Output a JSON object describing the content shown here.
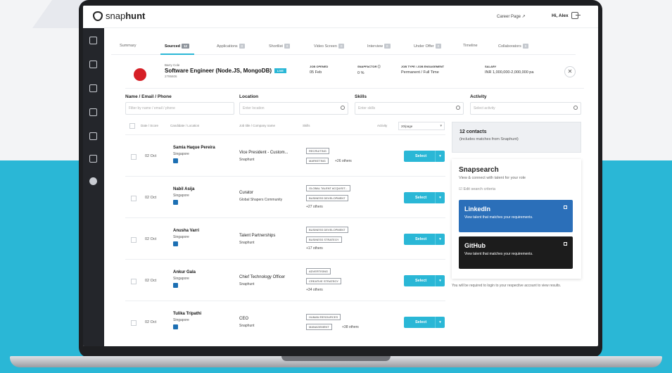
{
  "app": {
    "logo_prefix": "snap",
    "logo_suffix": "hunt",
    "career_page": "Career Page ↗",
    "user_greeting": "Hi, Alex"
  },
  "tabs": [
    {
      "label": "Summary",
      "count": ""
    },
    {
      "label": "Sourced",
      "count": "12"
    },
    {
      "label": "Applications",
      "count": "0"
    },
    {
      "label": "Shortlist",
      "count": "0"
    },
    {
      "label": "Video Screen",
      "count": "0"
    },
    {
      "label": "Interview",
      "count": "0"
    },
    {
      "label": "Under Offer",
      "count": "0"
    },
    {
      "label": "Timeline",
      "count": ""
    },
    {
      "label": "Collaborators",
      "count": "0"
    }
  ],
  "job": {
    "company": "Barry Cole",
    "title": "Software Engineer (Node.JS, MongoDB)",
    "badge": "LIVE",
    "id": "2795606",
    "openings_label": "JOB OPENED",
    "openings_value": "05 Feb",
    "snapfactor_label": "SNAPFACTOR ⓘ",
    "snapfactor_value": "0 %",
    "jobtype_label": "JOB TYPE / JOB ENGAGEMENT",
    "jobtype_value": "Permanent / Full Time",
    "salary_label": "SALARY",
    "salary_value": "INR 1,000,000-2,000,000 pa",
    "close": "✕"
  },
  "filters": {
    "name_label": "Name / Email / Phone",
    "name_placeholder": "Filter by name / email / phone",
    "location_label": "Location",
    "location_placeholder": "Enter location",
    "skills_label": "Skills",
    "skills_placeholder": "Enter skills",
    "activity_label": "Activity",
    "activity_placeholder": "Select activity"
  },
  "table": {
    "col_date": "Date / Score",
    "col_candidate": "Candidate / Location",
    "col_job": "Job title / Company name",
    "col_skills": "Skills",
    "col_activity": "Activity",
    "per_page": "20/page",
    "select_label": "Select",
    "rows": [
      {
        "date": "02 Oct",
        "name": "Samia Haque Pereira",
        "location": "Singapore",
        "job": "Vice President - Custom...",
        "company": "Snaphunt",
        "skills": [
          "RECRUITING",
          "MARKETING"
        ],
        "others": "+26 others"
      },
      {
        "date": "02 Oct",
        "name": "Nabil Asija",
        "location": "Singapore",
        "job": "Curator",
        "company": "Global Shapers Community",
        "skills": [
          "GLOBAL TALENT ACQUISIT...",
          "BUSINESS DEVELOPMENT"
        ],
        "others": "+27 others"
      },
      {
        "date": "02 Oct",
        "name": "Anusha Varri",
        "location": "Singapore",
        "job": "Talent Partnerships",
        "company": "Snaphunt",
        "skills": [
          "BUSINESS DEVELOPMENT",
          "BUSINESS STRATEGY"
        ],
        "others": "+17 others"
      },
      {
        "date": "02 Oct",
        "name": "Ankur Gala",
        "location": "Singapore",
        "job": "Chief Technology Officer",
        "company": "Snaphunt",
        "skills": [
          "ADVERTISING",
          "CREATIVE STRATEGY"
        ],
        "others": "+34 others"
      },
      {
        "date": "02 Oct",
        "name": "Tulika Tripathi",
        "location": "Singapore",
        "job": "CEO",
        "company": "Snaphunt",
        "skills": [
          "HUMAN RESOURCES",
          "MANAGEMENT"
        ],
        "others": "+38 others"
      }
    ]
  },
  "panel": {
    "contacts_count": "12 contacts",
    "contacts_sub": "(includes matches from Snaphunt)",
    "snapsearch_title": "Snapsearch",
    "snapsearch_sub": "View & connect with talent for your role",
    "edit_criteria": "☑ Edit search criteria",
    "linkedin_name": "LinkedIn",
    "linkedin_desc": "View talent that matches your requirements.",
    "github_name": "GitHub",
    "github_desc": "View talent that matches your requirements.",
    "note": "You will be required to login to your respective account to view results."
  }
}
